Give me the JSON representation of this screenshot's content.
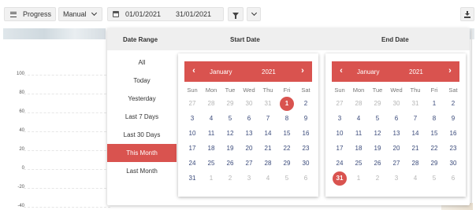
{
  "toolbar": {
    "progress_label": "Progress",
    "mode_value": "Manual",
    "start_date": "01/01/2021",
    "end_date": "31/01/2021"
  },
  "chart_axis": {
    "ticks": [
      "100",
      "80",
      "60",
      "40",
      "20",
      "0",
      "-20",
      "-40"
    ]
  },
  "panel": {
    "headers": {
      "date_range": "Date Range",
      "start_date": "Start Date",
      "end_date": "End Date"
    },
    "ranges": [
      "All",
      "Today",
      "Yesterday",
      "Last 7 Days",
      "Last 30 Days",
      "This Month",
      "Last Month"
    ],
    "active_range": "This Month",
    "weekday_labels": [
      "Sun",
      "Mon",
      "Tue",
      "Wed",
      "Thu",
      "Fri",
      "Sat"
    ],
    "start_calendar": {
      "month": "January",
      "year": "2021",
      "prev": "‹",
      "next": "›",
      "selected_day": "1",
      "days": [
        [
          "27",
          "28",
          "29",
          "30",
          "31",
          "1",
          "2"
        ],
        [
          "3",
          "4",
          "5",
          "6",
          "7",
          "8",
          "9"
        ],
        [
          "10",
          "11",
          "12",
          "13",
          "14",
          "15",
          "16"
        ],
        [
          "17",
          "18",
          "19",
          "20",
          "21",
          "22",
          "23"
        ],
        [
          "24",
          "25",
          "26",
          "27",
          "28",
          "29",
          "30"
        ],
        [
          "31",
          "1",
          "2",
          "3",
          "4",
          "5",
          "6"
        ]
      ]
    },
    "end_calendar": {
      "month": "January",
      "year": "2021",
      "prev": "‹",
      "next": "›",
      "selected_day": "31",
      "days": [
        [
          "27",
          "28",
          "29",
          "30",
          "31",
          "1",
          "2"
        ],
        [
          "3",
          "4",
          "5",
          "6",
          "7",
          "8",
          "9"
        ],
        [
          "10",
          "11",
          "12",
          "13",
          "14",
          "15",
          "16"
        ],
        [
          "17",
          "18",
          "19",
          "20",
          "21",
          "22",
          "23"
        ],
        [
          "24",
          "25",
          "26",
          "27",
          "28",
          "29",
          "30"
        ],
        [
          "31",
          "1",
          "2",
          "3",
          "4",
          "5",
          "6"
        ]
      ]
    }
  },
  "colors": {
    "accent": "#d9534f",
    "day_text": "#3a4a7a",
    "muted_day": "#b5b5b5"
  }
}
